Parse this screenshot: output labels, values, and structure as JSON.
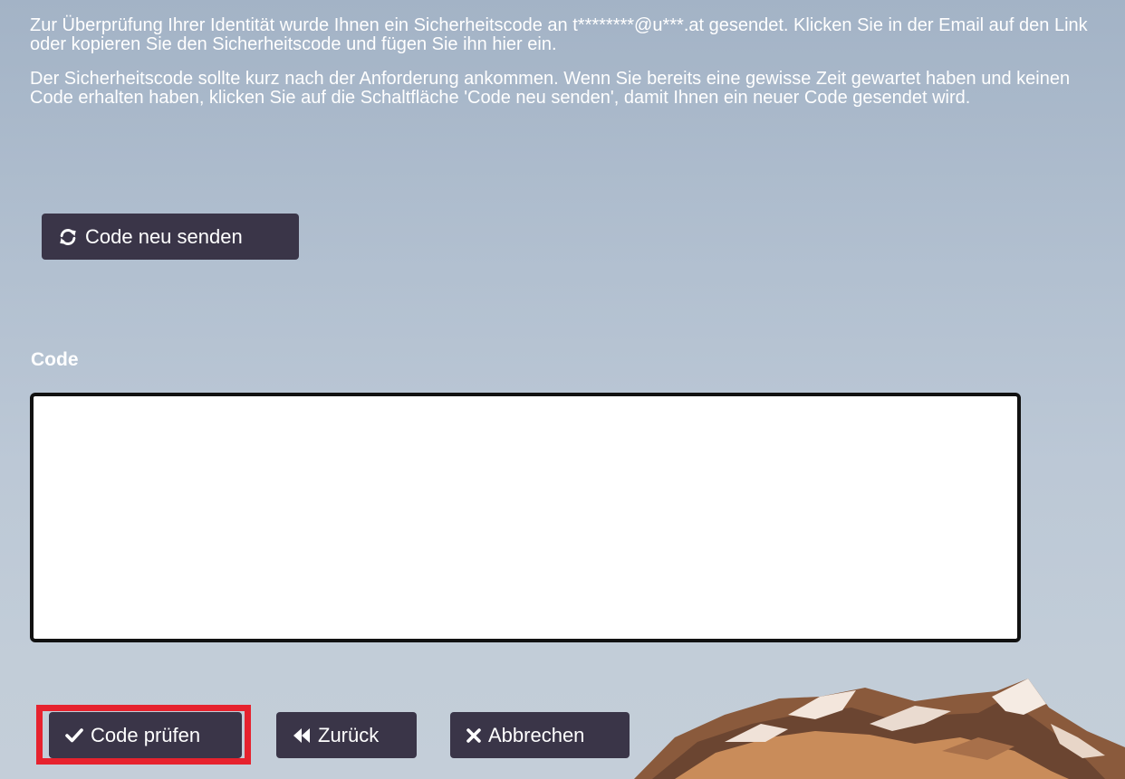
{
  "intro": {
    "paragraph_1": "Zur Überprüfung Ihrer Identität wurde Ihnen ein Sicherheitscode an t********@u***.at gesendet. Klicken Sie in der Email auf den Link oder kopieren Sie den Sicherheitscode und fügen Sie ihn hier ein.",
    "paragraph_2": "Der Sicherheitscode sollte kurz nach der Anforderung ankommen. Wenn Sie bereits eine gewisse Zeit gewartet haben und keinen Code erhalten haben, klicken Sie auf die Schaltfläche 'Code neu senden', damit Ihnen ein neuer Code gesendet wird."
  },
  "resend": {
    "label": "Code neu senden",
    "icon": "refresh-icon"
  },
  "code_field": {
    "label": "Code",
    "value": ""
  },
  "actions": {
    "check": {
      "label": "Code prüfen",
      "icon": "check-icon"
    },
    "back": {
      "label": "Zurück",
      "icon": "double-chevron-left-icon"
    },
    "cancel": {
      "label": "Abbrechen",
      "icon": "close-icon"
    }
  },
  "colors": {
    "button_bg": "#3a3548",
    "highlight_frame": "#e6222e",
    "text": "#ffffff"
  }
}
